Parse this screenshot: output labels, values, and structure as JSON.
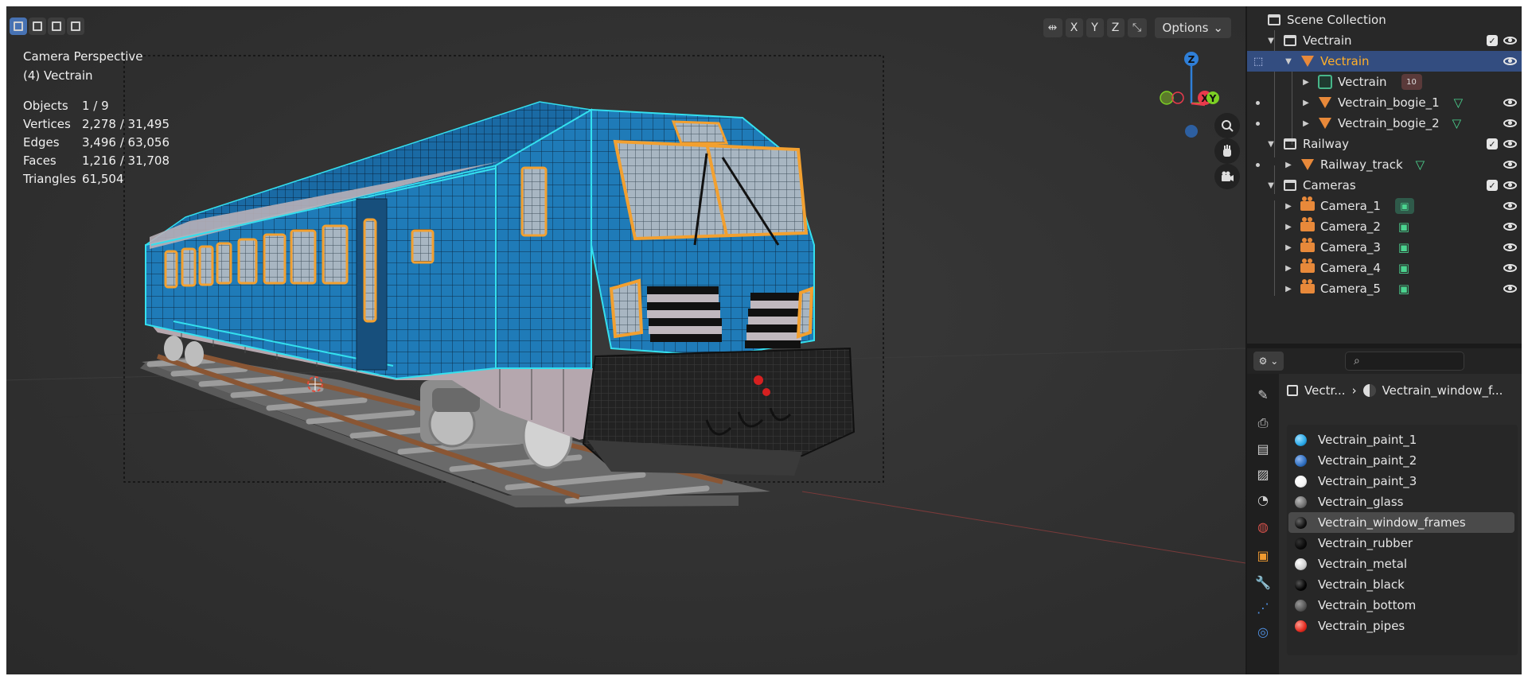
{
  "viewport": {
    "overlay": {
      "view_name": "Camera Perspective",
      "active_object": "(4) Vectrain"
    },
    "stats": [
      {
        "label": "Objects",
        "value": "1 / 9"
      },
      {
        "label": "Vertices",
        "value": "2,278 / 31,495"
      },
      {
        "label": "Edges",
        "value": "3,496 / 63,056"
      },
      {
        "label": "Faces",
        "value": "1,216 / 31,708"
      },
      {
        "label": "Triangles",
        "value": "61,504"
      }
    ],
    "header": {
      "axes": [
        "X",
        "Y",
        "Z"
      ],
      "options_label": "Options"
    },
    "gizmo": {
      "z": "Z",
      "x": "X",
      "y": "Y"
    },
    "nav_icons": [
      "zoom-icon",
      "hand-pan-icon",
      "camera-view-icon"
    ]
  },
  "outliner": {
    "rows": [
      {
        "label": "Scene Collection",
        "type": "scene"
      },
      {
        "label": "Vectrain",
        "type": "collection"
      },
      {
        "label": "Vectrain",
        "type": "mesh",
        "selected": true
      },
      {
        "label": "Vectrain",
        "type": "data",
        "badge": "10"
      },
      {
        "label": "Vectrain_bogie_1",
        "type": "mesh"
      },
      {
        "label": "Vectrain_bogie_2",
        "type": "mesh"
      },
      {
        "label": "Railway",
        "type": "collection"
      },
      {
        "label": "Railway_track",
        "type": "mesh"
      },
      {
        "label": "Cameras",
        "type": "collection"
      },
      {
        "label": "Camera_1",
        "type": "camera"
      },
      {
        "label": "Camera_2",
        "type": "camera"
      },
      {
        "label": "Camera_3",
        "type": "camera"
      },
      {
        "label": "Camera_4",
        "type": "camera"
      },
      {
        "label": "Camera_5",
        "type": "camera"
      }
    ]
  },
  "properties": {
    "breadcrumb": {
      "object": "Vectr...",
      "material": "Vectrain_window_f..."
    },
    "materials": [
      {
        "name": "Vectrain_paint_1",
        "color": "#29a8e8"
      },
      {
        "name": "Vectrain_paint_2",
        "color": "#2f6fc0"
      },
      {
        "name": "Vectrain_paint_3",
        "color": "#f2f2f2"
      },
      {
        "name": "Vectrain_glass",
        "color": "#707070"
      },
      {
        "name": "Vectrain_window_frames",
        "color": "#111111",
        "active": true
      },
      {
        "name": "Vectrain_rubber",
        "color": "#0a0a0a"
      },
      {
        "name": "Vectrain_metal",
        "color": "#cfcfcf"
      },
      {
        "name": "Vectrain_black",
        "color": "#050505"
      },
      {
        "name": "Vectrain_bottom",
        "color": "#555555"
      },
      {
        "name": "Vectrain_pipes",
        "color": "#e32a1e"
      }
    ]
  },
  "colors": {
    "accent": "#4772b3",
    "selected_text": "#ffaf29",
    "train_blue": "#1f7bb8",
    "wire_cyan": "#34e0ee",
    "select_orange": "#f2a030"
  }
}
